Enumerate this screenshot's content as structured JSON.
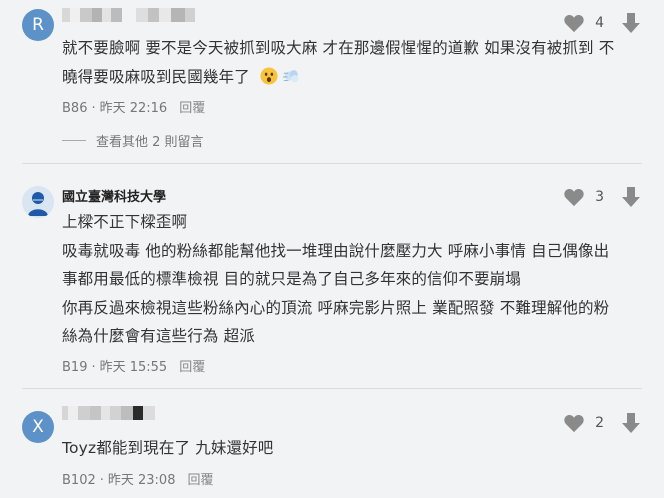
{
  "comments": [
    {
      "avatar_letter": "R",
      "author_masked": true,
      "likes": "4",
      "lines": [
        "就不要臉啊 要不是今天被抓到吸大麻 才在那邊假惺惺的道歉 如果沒有被抓到 不",
        "曉得要吸麻吸到民國幾年了"
      ],
      "floor": "B86",
      "time": "昨天 22:16",
      "reply": "回覆",
      "more_replies": "查看其他 2 則留言"
    },
    {
      "author": "國立臺灣科技大學",
      "likes": "3",
      "lines": [
        "上樑不正下樑歪啊",
        "吸毒就吸毒 他的粉絲都能幫他找一堆理由說什麼壓力大 呼麻小事情 自己偶像出",
        "事都用最低的標準檢視 目的就只是為了自己多年來的信仰不要崩塌",
        "你再反過來檢視這些粉絲內心的頂流 呼麻完影片照上 業配照發 不難理解他的粉",
        "絲為什麼會有這些行為 超派"
      ],
      "floor": "B19",
      "time": "昨天 15:55",
      "reply": "回覆"
    },
    {
      "avatar_letter": "X",
      "author_masked": true,
      "likes": "2",
      "lines": [
        "Toyz都能到現在了 九妹還好吧"
      ],
      "floor": "B102",
      "time": "昨天 23:08",
      "reply": "回覆"
    }
  ],
  "meta_separator": "·",
  "colors": {
    "avatar": "#5c92c8",
    "background": "#f2f3f4",
    "icon": "#8a8a8a"
  },
  "icons": [
    "heart-icon",
    "down-arrow-icon",
    "astonished-emoji",
    "dash-emoji",
    "school-logo"
  ]
}
